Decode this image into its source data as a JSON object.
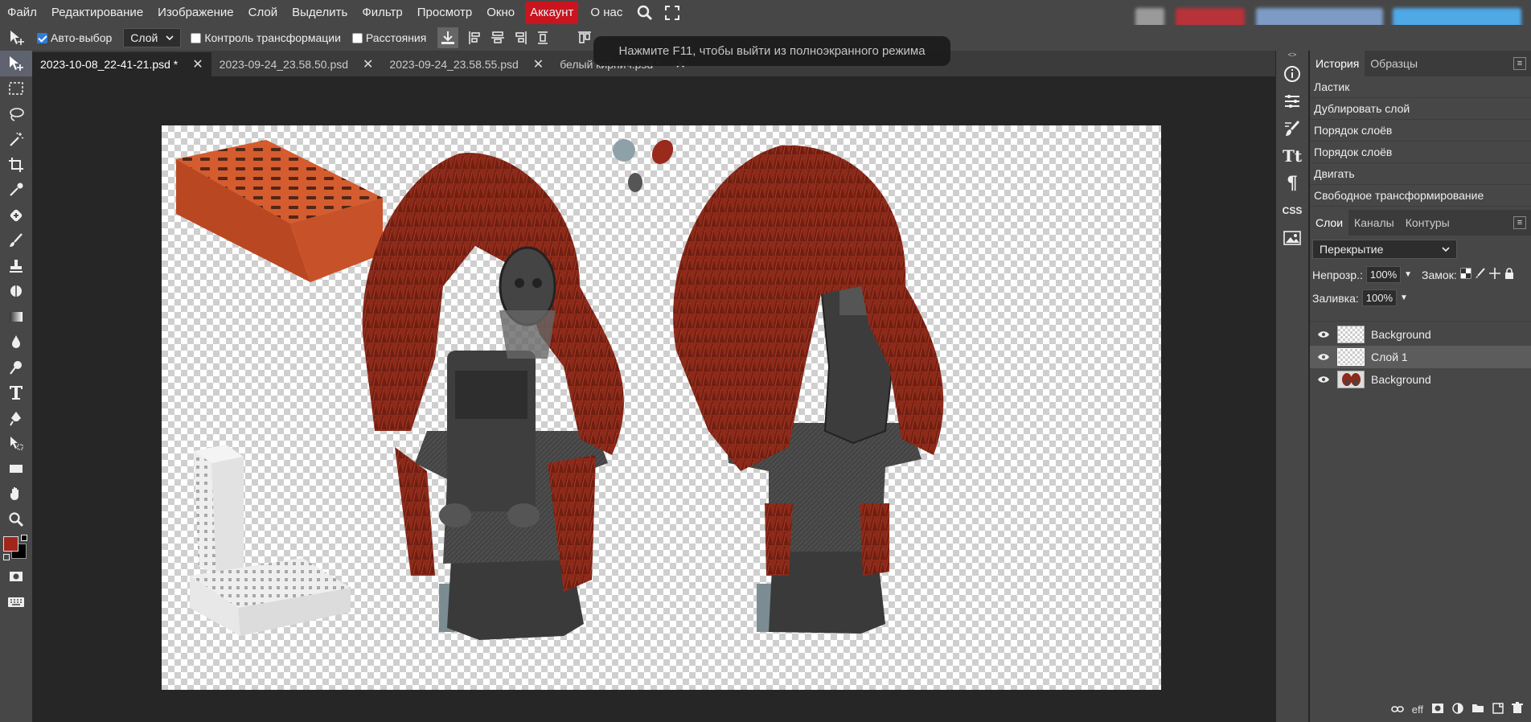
{
  "menu": {
    "items": [
      "Файл",
      "Редактирование",
      "Изображение",
      "Слой",
      "Выделить",
      "Фильтр",
      "Просмотр",
      "Окно"
    ],
    "account": "Аккаунт",
    "about": "О нас"
  },
  "options": {
    "auto_select_label": "Авто-выбор",
    "auto_select_checked": true,
    "target_select": "Слой",
    "transform_controls_label": "Контроль трансформации",
    "distances_label": "Расстояния"
  },
  "toast": "Нажмите F11, чтобы выйти из полноэкранного режима",
  "tabs": [
    {
      "label": "2023-10-08_22-41-21.psd *",
      "active": true
    },
    {
      "label": "2023-09-24_23.58.50.psd",
      "active": false
    },
    {
      "label": "2023-09-24_23.58.55.psd",
      "active": false
    },
    {
      "label": "белый кирпич.psd *",
      "active": false
    }
  ],
  "colors": {
    "foreground": "#a0251a",
    "background": "#000000",
    "fur": "#8e2a1a",
    "brick": "#d35a2c",
    "swatch_gray": "#8fa1a8"
  },
  "history": {
    "tab_history": "История",
    "tab_samples": "Образцы",
    "items": [
      "Ластик",
      "Дублировать слой",
      "Порядок слоёв",
      "Порядок слоёв",
      "Двигать",
      "Свободное трансформирование"
    ]
  },
  "layers": {
    "tab_layers": "Слои",
    "tab_channels": "Каналы",
    "tab_paths": "Контуры",
    "blend_mode": "Перекрытие",
    "opacity_label": "Непрозр.:",
    "opacity_value": "100%",
    "lock_label": "Замок:",
    "fill_label": "Заливка:",
    "fill_value": "100%",
    "items": [
      {
        "name": "Background",
        "selected": false
      },
      {
        "name": "Слой 1",
        "selected": true
      },
      {
        "name": "Background",
        "selected": false
      }
    ],
    "footer_eff": "eff"
  }
}
